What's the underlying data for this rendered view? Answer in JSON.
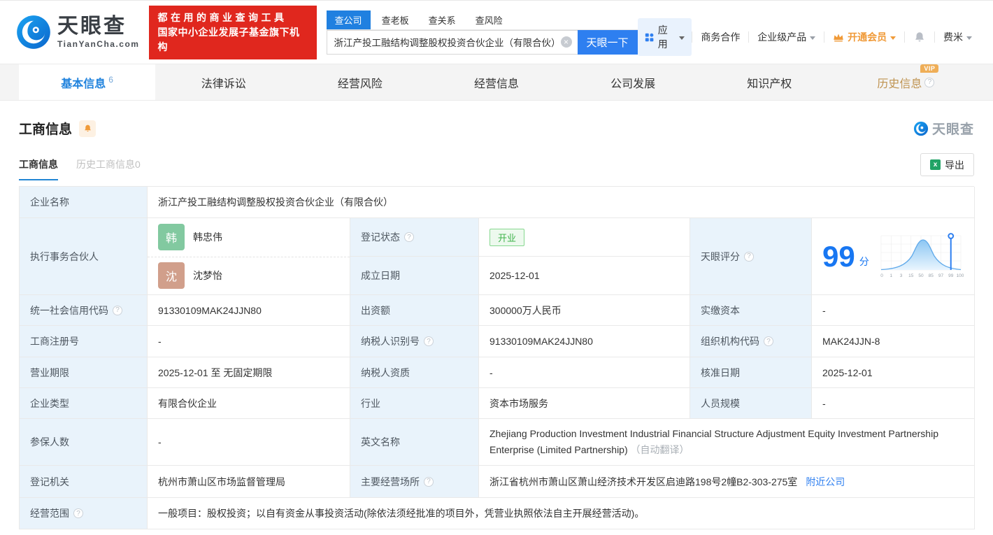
{
  "colors": {
    "brand_blue": "#2e7ff0",
    "search_tab_blue": "#2080e0",
    "active_tab_blue": "#1f82dd",
    "promo_red": "#e0271e",
    "vip_orange": "#f09a38",
    "history_tab_gold": "#bf9350",
    "status_green": "#3eb24a",
    "score_blue": "#1877f2",
    "label_cell_bg": "#e9f3fb",
    "avatar_green": "#82c9a0",
    "avatar_warm": "#d19f8b",
    "excel_green": "#21a366"
  },
  "header": {
    "logo_title": "天眼查",
    "logo_domain": "TianYanCha.com",
    "promo_line1": "都在用的商业查询工具",
    "promo_line2": "国家中小企业发展子基金旗下机构",
    "search_tabs": [
      "查公司",
      "查老板",
      "查关系",
      "查风险"
    ],
    "search_value": "浙江产投工融结构调整股权投资合伙企业（有限合伙）",
    "search_button": "天眼一下",
    "nav_apps": "应用",
    "nav_cooperation": "商务合作",
    "nav_enterprise": "企业级产品",
    "nav_vip": "开通会员",
    "nav_user": "费米"
  },
  "tabs": {
    "basic": "基本信息",
    "basic_count": "6",
    "legal": "法律诉讼",
    "risk": "经营风险",
    "operation": "经营信息",
    "development": "公司发展",
    "ip": "知识产权",
    "history": "历史信息",
    "history_vip": "VIP"
  },
  "section": {
    "title": "工商信息",
    "subtab_current": "工商信息",
    "subtab_history": "历史工商信息0",
    "watermark": "天眼查",
    "export": "导出"
  },
  "table": {
    "name_label": "企业名称",
    "name_value": "浙江产投工融结构调整股权投资合伙企业（有限合伙）",
    "partners_label": "执行事务合伙人",
    "partner1_initial": "韩",
    "partner1_name": "韩忠伟",
    "partner2_initial": "沈",
    "partner2_name": "沈梦怡",
    "status_label": "登记状态",
    "status_value": "开业",
    "established_label": "成立日期",
    "established_value": "2025-12-01",
    "score_label": "天眼评分",
    "score_value": "99",
    "score_unit": "分",
    "credit_code_label": "统一社会信用代码",
    "credit_code_value": "91330109MAK24JJN80",
    "capital_label": "出资额",
    "capital_value": "300000万人民币",
    "paid_capital_label": "实缴资本",
    "paid_capital_value": "-",
    "reg_no_label": "工商注册号",
    "reg_no_value": "-",
    "taxpayer_id_label": "纳税人识别号",
    "taxpayer_id_value": "91330109MAK24JJN80",
    "org_code_label": "组织机构代码",
    "org_code_value": "MAK24JJN-8",
    "term_label": "营业期限",
    "term_value": "2025-12-01 至 无固定期限",
    "taxpayer_quality_label": "纳税人资质",
    "taxpayer_quality_value": "-",
    "approval_date_label": "核准日期",
    "approval_date_value": "2025-12-01",
    "company_type_label": "企业类型",
    "company_type_value": "有限合伙企业",
    "industry_label": "行业",
    "industry_value": "资本市场服务",
    "staff_size_label": "人员规模",
    "staff_size_value": "-",
    "insured_label": "参保人数",
    "insured_value": "-",
    "english_name_label": "英文名称",
    "english_name_value": "Zhejiang Production Investment Industrial Financial Structure Adjustment Equity Investment Partnership Enterprise (Limited Partnership)",
    "english_name_note": "（自动翻译）",
    "registry_label": "登记机关",
    "registry_value": "杭州市萧山区市场监督管理局",
    "address_label": "主要经营场所",
    "address_value": "浙江省杭州市萧山区萧山经济技术开发区启迪路198号2幢B2-303-275室",
    "address_link": "附近公司",
    "scope_label": "经营范围",
    "scope_value": "一般项目：股权投资；以自有资金从事投资活动(除依法须经批准的项目外，凭营业执照依法自主开展经营活动)。"
  },
  "chart_data": {
    "type": "area",
    "title": "天眼评分分布曲线",
    "score": 99,
    "x_ticks": [
      "0",
      "1",
      "3",
      "15",
      "50",
      "85",
      "97",
      "99",
      "100"
    ],
    "marker_at": "99",
    "legend": "none",
    "grid": true
  }
}
